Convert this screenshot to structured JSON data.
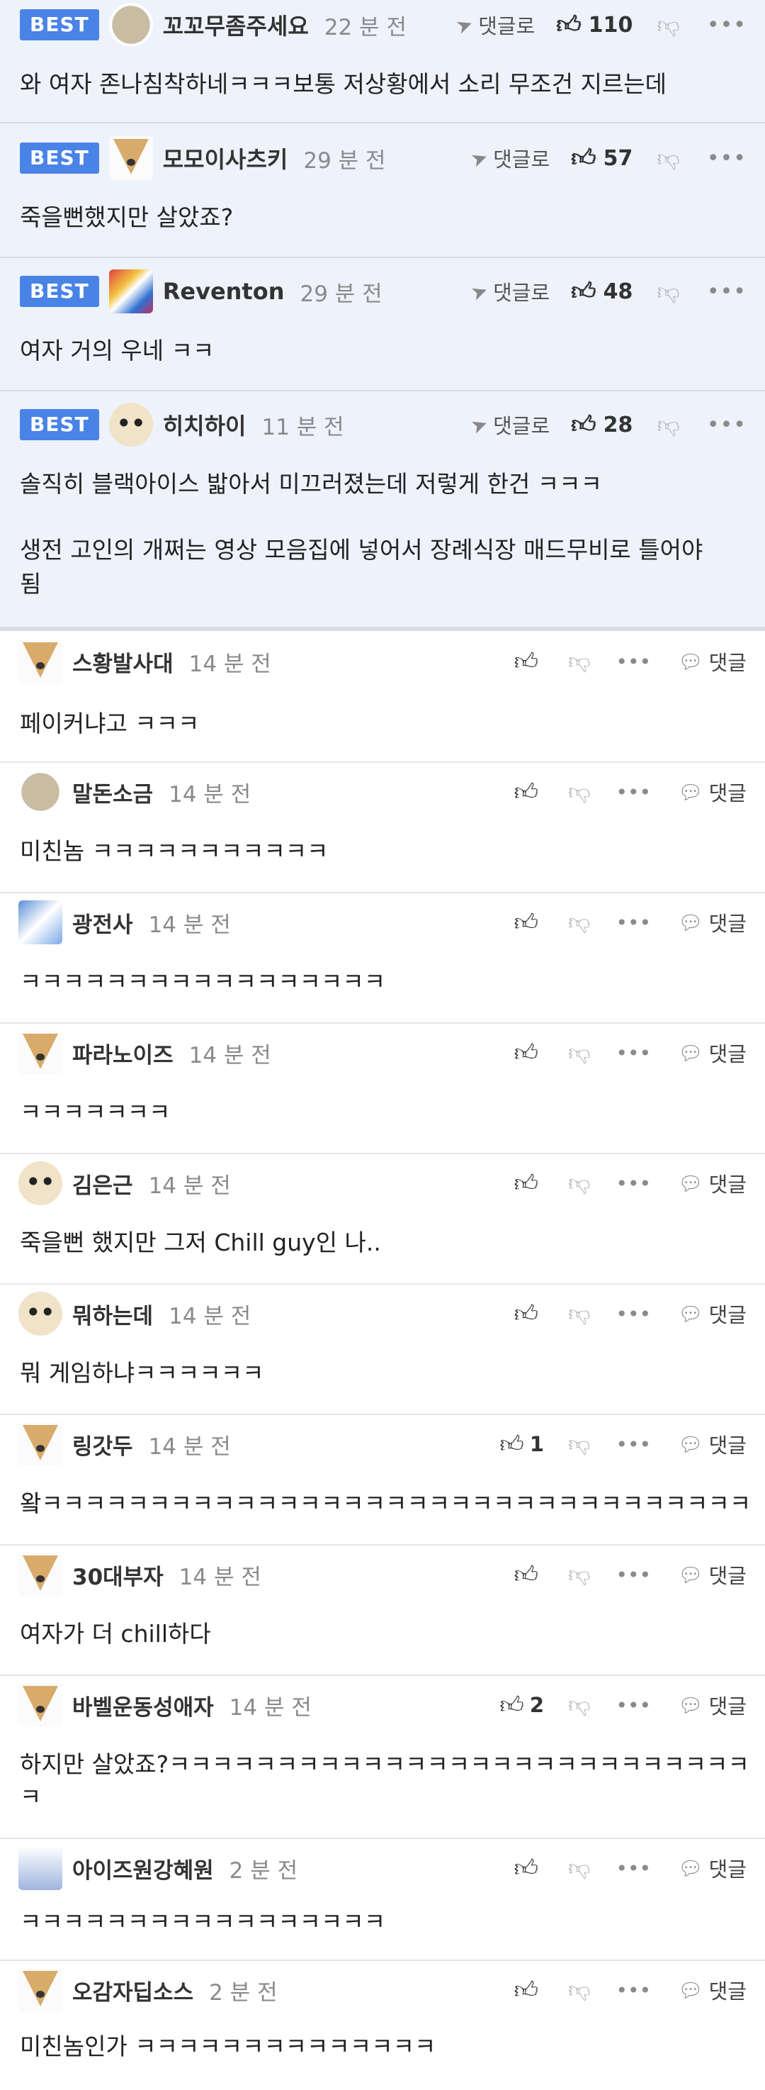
{
  "best_badge": "BEST",
  "best_reply_label": "댓글로",
  "comment_reply_label": "댓글",
  "best_comments": [
    {
      "nick": "꼬꼬무좀주세요",
      "time": "22 분 전",
      "likes": "110",
      "text": "와 여자 존나침착하네ㅋㅋㅋ보통 저상황에서 소리 무조건 지르는데",
      "avatar": "beige-icon"
    },
    {
      "nick": "모모이사츠키",
      "time": "29 분 전",
      "likes": "57",
      "text": "죽을뻔했지만 살았죠?",
      "avatar": "fox-icon"
    },
    {
      "nick": "Reventon",
      "time": "29 분 전",
      "likes": "48",
      "text": "여자 거의 우네 ㅋㅋ",
      "avatar": "color-icon"
    },
    {
      "nick": "히치하이",
      "time": "11 분 전",
      "likes": "28",
      "text1": "솔직히 블랙아이스 밟아서 미끄러졌는데 저렇게 한건 ㅋㅋㅋ",
      "text2": "생전 고인의 개쩌는 영상 모음집에 넣어서 장례식장 매드무비로 틀어야",
      "text3": "됨",
      "avatar": "dog-icon"
    }
  ],
  "comments": [
    {
      "nick": "스황발사대",
      "time": "14 분 전",
      "likes": "",
      "text": "페이커냐고 ㅋㅋㅋ",
      "avatar": "fox-icon"
    },
    {
      "nick": "말돈소금",
      "time": "14 분 전",
      "likes": "",
      "text": "미친놈 ㅋㅋㅋㅋㅋㅋㅋㅋㅋㅋㅋ",
      "avatar": "beige-icon"
    },
    {
      "nick": "광전사",
      "time": "14 분 전",
      "likes": "",
      "text": "ㅋㅋㅋㅋㅋㅋㅋㅋㅋㅋㅋㅋㅋㅋㅋㅋㅋ",
      "avatar": "blue-icon"
    },
    {
      "nick": "파라노이즈",
      "time": "14 분 전",
      "likes": "",
      "text": "ㅋㅋㅋㅋㅋㅋㅋ",
      "avatar": "fox-icon"
    },
    {
      "nick": "김은근",
      "time": "14 분 전",
      "likes": "",
      "text": "죽을뻔 했지만 그저 Chill guy인 나..",
      "avatar": "dog-icon"
    },
    {
      "nick": "뭐하는데",
      "time": "14 분 전",
      "likes": "",
      "text": "뭐 게임하냐ㅋㅋㅋㅋㅋㅋ",
      "avatar": "dog-icon"
    },
    {
      "nick": "링갓두",
      "time": "14 분 전",
      "likes": "1",
      "text": "왘ㅋㅋㅋㅋㅋㅋㅋㅋㅋㅋㅋㅋㅋㅋㅋㅋㅋㅋㅋㅋㅋㅋㅋㅋㅋㅋㅋㅋㅋㅋㅋㅋㅋ",
      "avatar": "fox-icon"
    },
    {
      "nick": "30대부자",
      "time": "14 분 전",
      "likes": "",
      "text": "여자가 더 chill하다",
      "avatar": "fox-icon"
    },
    {
      "nick": "바벨운동성애자",
      "time": "14 분 전",
      "likes": "2",
      "text1": "하지만 살았죠?ㅋㅋㅋㅋㅋㅋㅋㅋㅋㅋㅋㅋㅋㅋㅋㅋㅋㅋㅋㅋㅋㅋㅋㅋㅋㅋㅋ",
      "text2": "ㅋ",
      "avatar": "fox-icon"
    },
    {
      "nick": "아이즈원강혜원",
      "time": "2 분 전",
      "likes": "",
      "text": "ㅋㅋㅋㅋㅋㅋㅋㅋㅋㅋㅋㅋㅋㅋㅋㅋㅋ",
      "avatar": "robot-icon"
    },
    {
      "nick": "오감자딥소스",
      "time": "2 분 전",
      "likes": "",
      "text": "미친놈인가 ㅋㅋㅋㅋㅋㅋㅋㅋㅋㅋㅋㅋㅋㅋ",
      "avatar": "fox-icon"
    }
  ]
}
